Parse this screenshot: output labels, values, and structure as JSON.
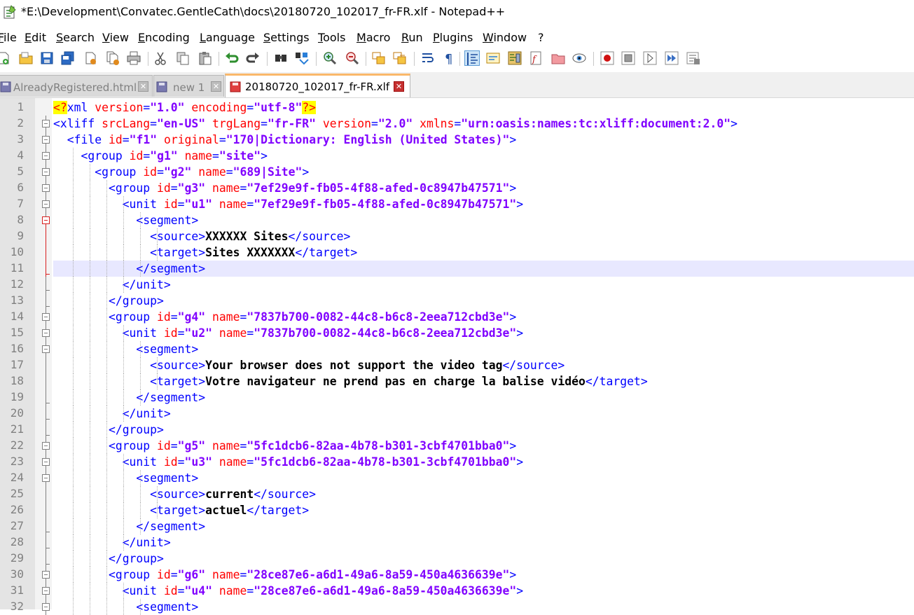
{
  "window": {
    "title": "*E:\\Development\\Convatec.GentleCath\\docs\\20180720_102017_fr-FR.xlf - Notepad++"
  },
  "menu": [
    "File",
    "Edit",
    "Search",
    "View",
    "Encoding",
    "Language",
    "Settings",
    "Tools",
    "Macro",
    "Run",
    "Plugins",
    "Window",
    "?"
  ],
  "toolbar": {
    "buttons": [
      "new-file-icon",
      "open-file-icon",
      "save-icon",
      "save-all-icon",
      "close-icon",
      "close-all-icon",
      "print-icon",
      "cut-icon",
      "copy-icon",
      "paste-icon",
      "undo-icon",
      "redo-icon",
      "find-icon",
      "replace-icon",
      "zoom-in-icon",
      "zoom-out-icon",
      "sync-vertical-icon",
      "sync-horizontal-icon",
      "word-wrap-icon",
      "show-all-chars-icon",
      "indent-guide-icon",
      "udl-icon",
      "doc-map-icon",
      "function-list-icon",
      "folder-workspace-icon",
      "monitor-icon",
      "record-macro-icon",
      "stop-record-icon",
      "play-macro-icon",
      "run-macro-multiple-icon",
      "save-macro-icon"
    ]
  },
  "tabs": [
    {
      "label": "AlreadyRegistered.html",
      "active": false
    },
    {
      "label": "new 1",
      "active": false
    },
    {
      "label": "20180720_102017_fr-FR.xlf",
      "active": true
    }
  ],
  "editor": {
    "current_line": 11,
    "lines": [
      {
        "n": "1",
        "text": "<?xml version=\"1.0\" encoding=\"utf-8\"?>"
      },
      {
        "n": "2",
        "text": "<xliff srcLang=\"en-US\" trgLang=\"fr-FR\" version=\"2.0\" xmlns=\"urn:oasis:names:tc:xliff:document:2.0\">"
      },
      {
        "n": "3",
        "text": "  <file id=\"f1\" original=\"170|Dictionary: English (United States)\">"
      },
      {
        "n": "4",
        "text": "    <group id=\"g1\" name=\"site\">"
      },
      {
        "n": "5",
        "text": "      <group id=\"g2\" name=\"689|Site\">"
      },
      {
        "n": "6",
        "text": "        <group id=\"g3\" name=\"7ef29e9f-fb05-4f88-afed-0c8947b47571\">"
      },
      {
        "n": "7",
        "text": "          <unit id=\"u1\" name=\"7ef29e9f-fb05-4f88-afed-0c8947b47571\">"
      },
      {
        "n": "8",
        "text": "            <segment>"
      },
      {
        "n": "9",
        "text": "              <source>XXXXXX Sites</source>"
      },
      {
        "n": "10",
        "text": "              <target>Sites XXXXXXX</target>"
      },
      {
        "n": "11",
        "text": "            </segment>"
      },
      {
        "n": "12",
        "text": "          </unit>"
      },
      {
        "n": "13",
        "text": "        </group>"
      },
      {
        "n": "14",
        "text": "        <group id=\"g4\" name=\"7837b700-0082-44c8-b6c8-2eea712cbd3e\">"
      },
      {
        "n": "15",
        "text": "          <unit id=\"u2\" name=\"7837b700-0082-44c8-b6c8-2eea712cbd3e\">"
      },
      {
        "n": "16",
        "text": "            <segment>"
      },
      {
        "n": "17",
        "text": "              <source>Your browser does not support the video tag</source>"
      },
      {
        "n": "18",
        "text": "              <target>Votre navigateur ne prend pas en charge la balise vidéo</target>"
      },
      {
        "n": "19",
        "text": "            </segment>"
      },
      {
        "n": "20",
        "text": "          </unit>"
      },
      {
        "n": "21",
        "text": "        </group>"
      },
      {
        "n": "22",
        "text": "        <group id=\"g5\" name=\"5fc1dcb6-82aa-4b78-b301-3cbf4701bba0\">"
      },
      {
        "n": "23",
        "text": "          <unit id=\"u3\" name=\"5fc1dcb6-82aa-4b78-b301-3cbf4701bba0\">"
      },
      {
        "n": "24",
        "text": "            <segment>"
      },
      {
        "n": "25",
        "text": "              <source>current</source>"
      },
      {
        "n": "26",
        "text": "              <target>actuel</target>"
      },
      {
        "n": "27",
        "text": "            </segment>"
      },
      {
        "n": "28",
        "text": "          </unit>"
      },
      {
        "n": "29",
        "text": "        </group>"
      },
      {
        "n": "30",
        "text": "        <group id=\"g6\" name=\"28ce87e6-a6d1-49a6-8a59-450a4636639e\">"
      },
      {
        "n": "31",
        "text": "          <unit id=\"u4\" name=\"28ce87e6-a6d1-49a6-8a59-450a4636639e\">"
      },
      {
        "n": "32",
        "text": "            <segment>"
      }
    ]
  },
  "colors": {
    "tag": "#0000ff",
    "attribute": "#ff0000",
    "value": "#8000ff",
    "text": "#000000",
    "current_line_bg": "#e8e8ff",
    "gutter_bg": "#e4e4e4",
    "active_tab_accent": "#fab86a"
  }
}
